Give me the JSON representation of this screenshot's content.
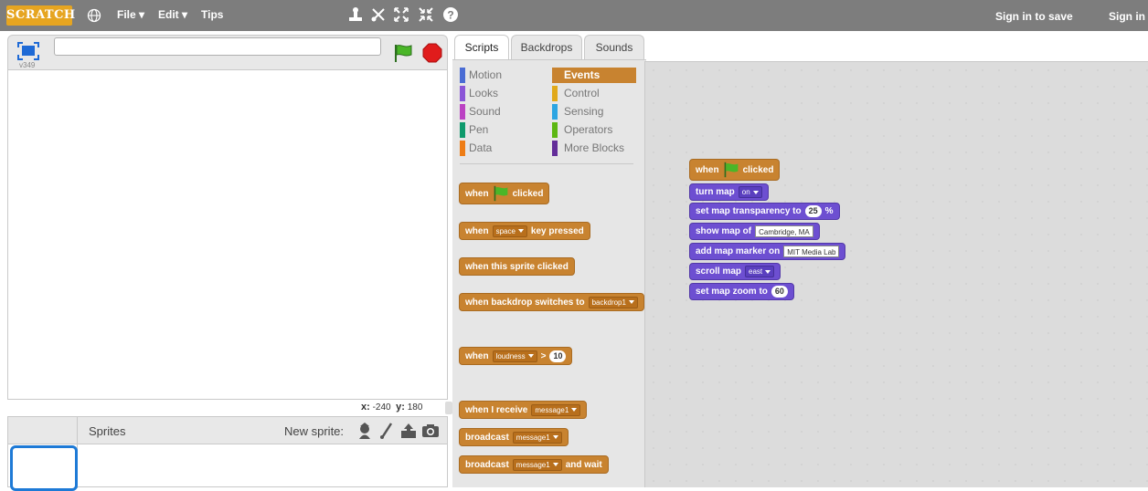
{
  "topbar": {
    "logo": "SCRATCH",
    "menu": [
      "File",
      "Edit",
      "Tips"
    ],
    "sign_in_save": "Sign in to save",
    "sign_in": "Sign in",
    "colors": {
      "bar": "#7d7d7d",
      "logo": "#e6a521"
    }
  },
  "stage": {
    "version": "v349",
    "title_value": "",
    "coords": {
      "x_label": "x:",
      "x_value": "-240",
      "y_label": "y:",
      "y_value": "180"
    }
  },
  "sprites": {
    "label": "Sprites",
    "new_sprite": "New sprite:"
  },
  "tabs": [
    "Scripts",
    "Backdrops",
    "Sounds"
  ],
  "categories": {
    "left": [
      {
        "label": "Motion",
        "color": "#4a6cd4"
      },
      {
        "label": "Looks",
        "color": "#8a55d7"
      },
      {
        "label": "Sound",
        "color": "#bb42c3"
      },
      {
        "label": "Pen",
        "color": "#0e9a6c"
      },
      {
        "label": "Data",
        "color": "#ee7d16"
      }
    ],
    "right": [
      {
        "label": "Events",
        "color": "#c88330"
      },
      {
        "label": "Control",
        "color": "#e1a91a"
      },
      {
        "label": "Sensing",
        "color": "#2ca5e2"
      },
      {
        "label": "Operators",
        "color": "#5cb712"
      },
      {
        "label": "More Blocks",
        "color": "#632d99"
      }
    ]
  },
  "palette": {
    "when_flag": {
      "a": "when",
      "b": "clicked"
    },
    "when_key": {
      "a": "when",
      "key": "space",
      "b": "key pressed"
    },
    "when_sprite": "when this sprite clicked",
    "when_backdrop": {
      "a": "when backdrop switches to",
      "dd": "backdrop1"
    },
    "when_loudness": {
      "a": "when",
      "dd": "loudness",
      "op": ">",
      "num": "10"
    },
    "when_receive": {
      "a": "when I receive",
      "dd": "message1"
    },
    "broadcast": {
      "a": "broadcast",
      "dd": "message1"
    },
    "broadcast_wait": {
      "a": "broadcast",
      "dd": "message1",
      "b": "and wait"
    }
  },
  "script": {
    "hat": {
      "a": "when",
      "b": "clicked"
    },
    "turn_map": {
      "a": "turn map",
      "dd": "on"
    },
    "transparency": {
      "a": "set map transparency to",
      "num": "25",
      "b": "%"
    },
    "show_map": {
      "a": "show map of",
      "txt": "Cambridge, MA"
    },
    "marker": {
      "a": "add map marker on",
      "txt": "MIT Media Lab"
    },
    "scroll": {
      "a": "scroll map",
      "dd": "east"
    },
    "zoom": {
      "a": "set map zoom to",
      "num": "60"
    }
  }
}
